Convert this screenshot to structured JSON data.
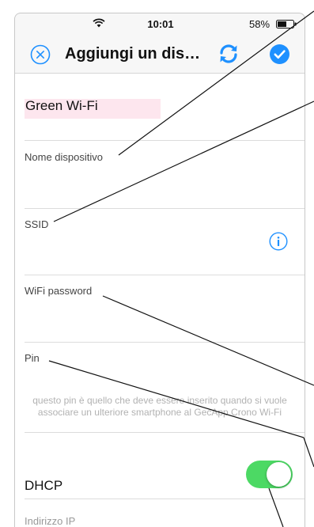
{
  "status_bar": {
    "time": "10:01",
    "battery_percent": "58%",
    "battery_level": 0.58,
    "wifi_icon": "wifi-icon"
  },
  "nav": {
    "title": "Aggiungi un dis…",
    "close_icon": "close-circle-icon",
    "refresh_icon": "refresh-icon",
    "confirm_icon": "checkmark-circle-icon",
    "accent_color": "#1e90ff"
  },
  "form": {
    "device_name_value": "Green Wi-Fi",
    "device_name_label": "Nome dispositivo",
    "ssid_label": "SSID",
    "ssid_info_icon": "info-icon",
    "wifi_password_label": "WiFi password",
    "pin_label": "Pin",
    "pin_helper": "questo pin è quello che deve essere inserito quando si vuole associare un ulteriore smartphone al GecApp Crono Wi-Fi",
    "dhcp_label": "DHCP",
    "dhcp_enabled": true,
    "dhcp_toggle_color": "#4cd964",
    "ip_label": "Indirizzo IP"
  }
}
